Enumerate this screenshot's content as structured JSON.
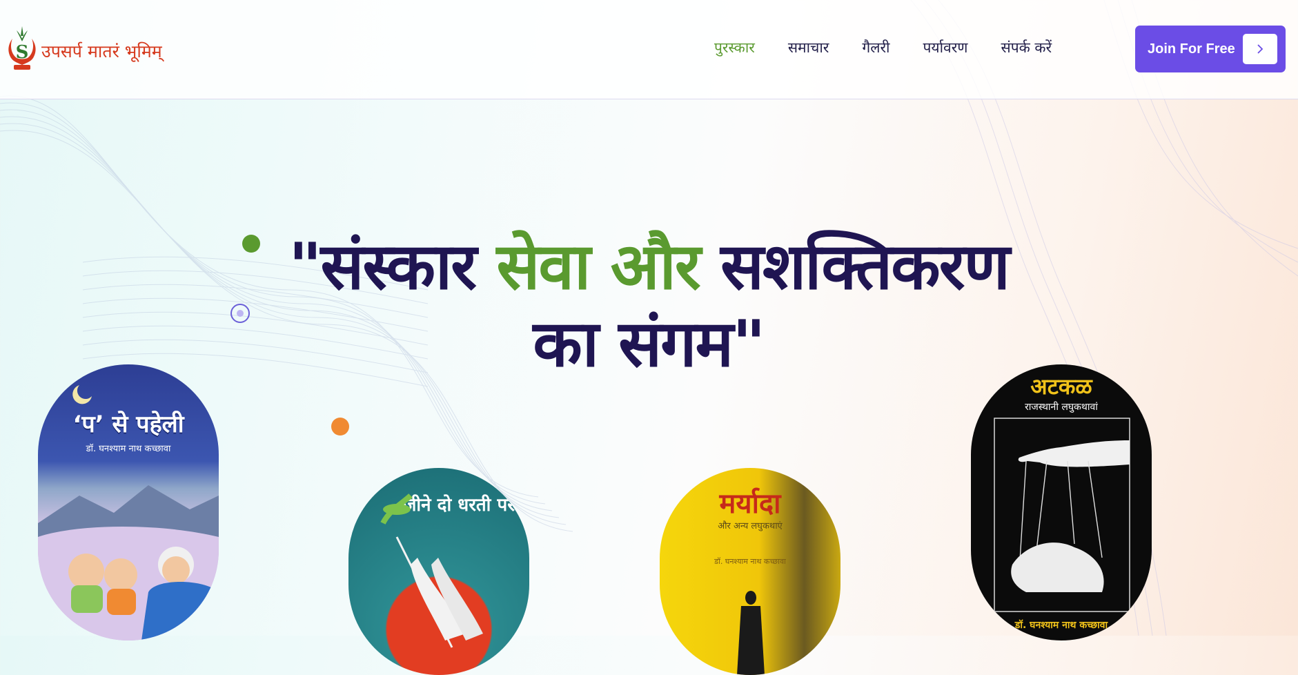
{
  "header": {
    "logo_text": "उपसर्प मातरं भूमिम्",
    "nav": [
      "पुरस्कार",
      "समाचार",
      "गैलरी",
      "पर्यावरण",
      "संपर्क करें"
    ],
    "active_nav": "पुरस्कार",
    "cta_label": "Join For Free"
  },
  "hero": {
    "line1_part1": "\"संस्कार",
    "line1_green": "सेवा और",
    "line1_part2": "सशक्तिकरण",
    "line2": "का संगम\""
  },
  "books": [
    {
      "title": "‘प’ से पहेली",
      "author": "डॉ. घनश्याम नाथ कच्छावा"
    },
    {
      "title": "जीने दो धरती पर",
      "author": ""
    },
    {
      "title": "मर्यादा",
      "subtitle": "और अन्य लघुकथाएं",
      "author": "डॉ. घनश्याम नाथ कच्छावा"
    },
    {
      "title": "अटकळ",
      "subtitle": "राजस्थानी लघुकथावां",
      "author": "डॉ. घनश्याम नाथ कच्छावा"
    }
  ],
  "colors": {
    "brand_green": "#5a9a2f",
    "dark_navy": "#1f1552",
    "cta_purple": "#6b4de6",
    "logo_red": "#d63a1e",
    "accent_orange": "#f08a32"
  }
}
